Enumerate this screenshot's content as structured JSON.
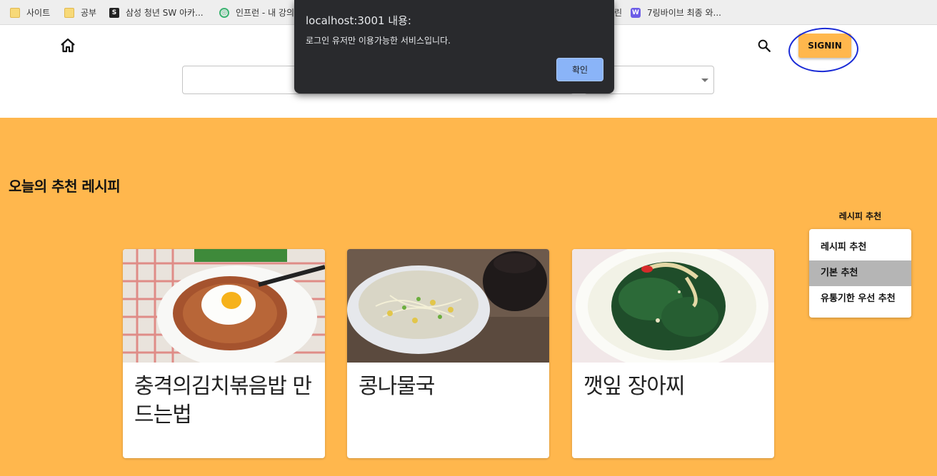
{
  "bookmarks": [
    {
      "label": "사이트",
      "icon": "folder-icon"
    },
    {
      "label": "공부",
      "icon": "folder-icon"
    },
    {
      "label": "삼성 청년 SW 아카...",
      "icon": "ssafy-icon",
      "icon_text": "S"
    },
    {
      "label": "인프런 - 내 강의",
      "icon": "inflearn-icon",
      "icon_text": "◎"
    },
    {
      "label": "린",
      "icon": ""
    },
    {
      "label": "7링바이브 최종 와...",
      "icon": "wiki-icon",
      "icon_text": "W"
    }
  ],
  "header": {
    "signin_label": "SIGNIN",
    "search_placeholder": ""
  },
  "main": {
    "section_title": "오늘의 추천 레시피",
    "cards": [
      {
        "title": "충격의김치볶음밥 만드는법"
      },
      {
        "title": "콩나물국"
      },
      {
        "title": "깻잎 장아찌"
      }
    ]
  },
  "side": {
    "title": "레시피 추천",
    "items": [
      {
        "label": "레시피 추천"
      },
      {
        "label": "기본 추천"
      },
      {
        "label": "유통기한 우선 추천"
      }
    ]
  },
  "alert": {
    "title": "localhost:3001 내용:",
    "message": "로그인 유저만 이용가능한 서비스입니다.",
    "ok_label": "확인"
  },
  "colors": {
    "accent": "#ffb74d",
    "dialog_bg": "#292a2d",
    "dialog_button": "#8ab4f8",
    "annotation_circle": "#1a2bd6"
  }
}
